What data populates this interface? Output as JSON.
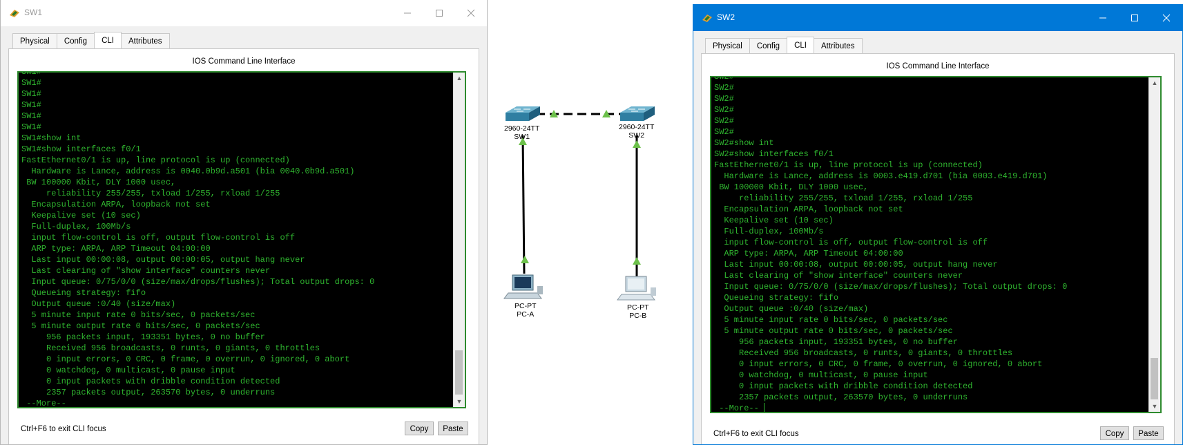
{
  "sw1": {
    "title": "SW1",
    "tabs": [
      "Physical",
      "Config",
      "CLI",
      "Attributes"
    ],
    "active_tab": "CLI",
    "panel_title": "IOS Command Line Interface",
    "terminal": "SW1#\nSW1#\nSW1#\nSW1#\nSW1#\nSW1#\nSW1#show int\nSW1#show interfaces f0/1\nFastEthernet0/1 is up, line protocol is up (connected)\n  Hardware is Lance, address is 0040.0b9d.a501 (bia 0040.0b9d.a501)\n BW 100000 Kbit, DLY 1000 usec,\n     reliability 255/255, txload 1/255, rxload 1/255\n  Encapsulation ARPA, loopback not set\n  Keepalive set (10 sec)\n  Full-duplex, 100Mb/s\n  input flow-control is off, output flow-control is off\n  ARP type: ARPA, ARP Timeout 04:00:00\n  Last input 00:00:08, output 00:00:05, output hang never\n  Last clearing of \"show interface\" counters never\n  Input queue: 0/75/0/0 (size/max/drops/flushes); Total output drops: 0\n  Queueing strategy: fifo\n  Output queue :0/40 (size/max)\n  5 minute input rate 0 bits/sec, 0 packets/sec\n  5 minute output rate 0 bits/sec, 0 packets/sec\n     956 packets input, 193351 bytes, 0 no buffer\n     Received 956 broadcasts, 0 runts, 0 giants, 0 throttles\n     0 input errors, 0 CRC, 0 frame, 0 overrun, 0 ignored, 0 abort\n     0 watchdog, 0 multicast, 0 pause input\n     0 input packets with dribble condition detected\n     2357 packets output, 263570 bytes, 0 underruns\n --More--",
    "hint": "Ctrl+F6 to exit CLI focus",
    "copy_label": "Copy",
    "paste_label": "Paste"
  },
  "sw2": {
    "title": "SW2",
    "tabs": [
      "Physical",
      "Config",
      "CLI",
      "Attributes"
    ],
    "active_tab": "CLI",
    "panel_title": "IOS Command Line Interface",
    "terminal": "SW2#\nSW2#\nSW2#\nSW2#\nSW2#\nSW2#\nSW2#show int\nSW2#show interfaces f0/1\nFastEthernet0/1 is up, line protocol is up (connected)\n  Hardware is Lance, address is 0003.e419.d701 (bia 0003.e419.d701)\n BW 100000 Kbit, DLY 1000 usec,\n     reliability 255/255, txload 1/255, rxload 1/255\n  Encapsulation ARPA, loopback not set\n  Keepalive set (10 sec)\n  Full-duplex, 100Mb/s\n  input flow-control is off, output flow-control is off\n  ARP type: ARPA, ARP Timeout 04:00:00\n  Last input 00:00:08, output 00:00:05, output hang never\n  Last clearing of \"show interface\" counters never\n  Input queue: 0/75/0/0 (size/max/drops/flushes); Total output drops: 0\n  Queueing strategy: fifo\n  Output queue :0/40 (size/max)\n  5 minute input rate 0 bits/sec, 0 packets/sec\n  5 minute output rate 0 bits/sec, 0 packets/sec\n     956 packets input, 193351 bytes, 0 no buffer\n     Received 956 broadcasts, 0 runts, 0 giants, 0 throttles\n     0 input errors, 0 CRC, 0 frame, 0 overrun, 0 ignored, 0 abort\n     0 watchdog, 0 multicast, 0 pause input\n     0 input packets with dribble condition detected\n     2357 packets output, 263570 bytes, 0 underruns\n --More-- ",
    "hint": "Ctrl+F6 to exit CLI focus",
    "copy_label": "Copy",
    "paste_label": "Paste"
  },
  "topology": {
    "sw1": {
      "model": "2960-24TT",
      "name": "SW1"
    },
    "sw2": {
      "model": "2960-24TT",
      "name": "SW2"
    },
    "pca": {
      "model": "PC-PT",
      "name": "PC-A"
    },
    "pcb": {
      "model": "PC-PT",
      "name": "PC-B"
    },
    "link_up_color": "#6cc04a"
  },
  "colors": {
    "terminal_bg": "#000000",
    "terminal_text": "#2fb52f",
    "active_titlebar": "#0078d7"
  }
}
